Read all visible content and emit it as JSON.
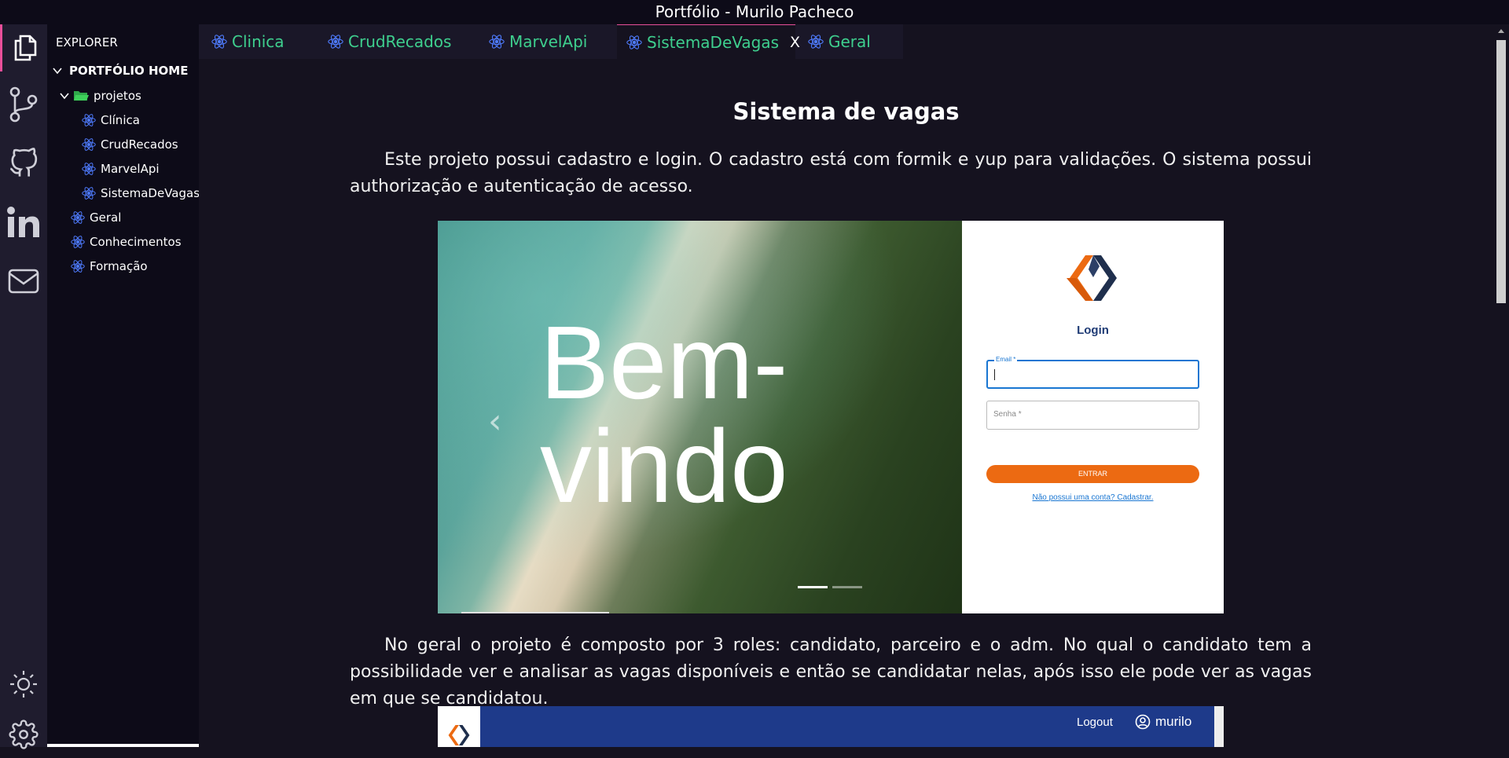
{
  "window": {
    "title": "Portfólio - Murilo Pacheco"
  },
  "activity_bar": [
    {
      "icon": "files-icon",
      "active": true
    },
    {
      "icon": "source-control-icon",
      "active": false
    },
    {
      "icon": "github-icon",
      "active": false
    },
    {
      "icon": "linkedin-icon",
      "active": false
    },
    {
      "icon": "mail-icon",
      "active": false
    },
    {
      "icon": "sun-icon",
      "active": false
    },
    {
      "icon": "gear-icon",
      "active": false
    }
  ],
  "sidebar": {
    "title": "EXPLORER",
    "root": "PORTFÓLIO HOME",
    "folder": "projetos",
    "projects": [
      "Clínica",
      "CrudRecados",
      "MarvelApi",
      "SistemaDeVagas"
    ],
    "items": [
      "Geral",
      "Conhecimentos",
      "Formação"
    ]
  },
  "tabs": [
    {
      "label": "Clinica",
      "active": false
    },
    {
      "label": "CrudRecados",
      "active": false
    },
    {
      "label": "MarvelApi",
      "active": false
    },
    {
      "label": "SistemaDeVagas",
      "active": true,
      "close": "X"
    },
    {
      "label": "Geral",
      "active": false
    }
  ],
  "content": {
    "title": "Sistema de vagas",
    "paragraph1": "Este projeto possui cadastro e login. O cadastro está com formik e yup para validações. O sistema possui authorização e autenticação de acesso.",
    "paragraph2": "No geral o projeto é composto por 3 roles: candidato, parceiro e o adm. No qual o candidato tem a possibilidade ver e analisar as vagas disponíveis e então se candidatar nelas, após isso ele pode ver as vagas em que se candidatou."
  },
  "screenshot1": {
    "hero_text_line1": "Bem-",
    "hero_text_line2": "vindo",
    "login_title": "Login",
    "email_label": "Email *",
    "password_label": "Senha *",
    "submit_label": "ENTRAR",
    "signup_link": "Não possui uma conta? Cadastrar."
  },
  "screenshot2": {
    "logout_label": "Logout",
    "user_name": "murilo"
  },
  "colors": {
    "accent_tab": "#3ecf8e",
    "active_border": "#e94f9a",
    "react_icon": "#4f7cff",
    "folder": "#3ecf5a",
    "entrar_button": "#ec6a12"
  }
}
